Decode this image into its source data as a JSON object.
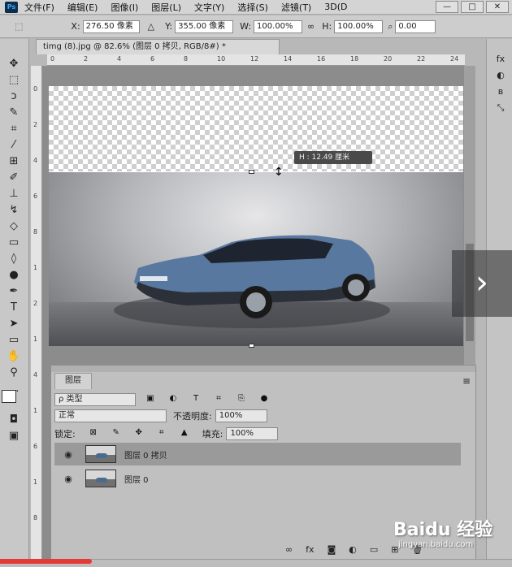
{
  "menubar": {
    "logo": "Ps",
    "items": [
      "文件(F)",
      "编辑(E)",
      "图像(I)",
      "图层(L)",
      "文字(Y)",
      "选择(S)",
      "滤镜(T)",
      "3D(D"
    ]
  },
  "window_controls": [
    "—",
    "□",
    "✕"
  ],
  "options": {
    "x_label": "X:",
    "x_value": "276.50 像素",
    "y_label": "Y:",
    "y_value": "355.00 像素",
    "w_label": "W:",
    "w_value": "100.00%",
    "h_label": "H:",
    "h_value": "100.00%",
    "angle_value": "0.00"
  },
  "document": {
    "tab_title": "timg (8).jpg @ 82.6% (图层 0 拷贝, RGB/8#) *",
    "tab_close": "×"
  },
  "ruler_top_labels": [
    "0",
    "2",
    "4",
    "6",
    "8",
    "10",
    "12",
    "14",
    "16",
    "18",
    "20",
    "22",
    "24"
  ],
  "ruler_left_labels": [
    "0",
    "2",
    "4",
    "6",
    "8",
    "1",
    "2",
    "1",
    "4",
    "1",
    "6",
    "1",
    "8"
  ],
  "hud": {
    "text": "H :  12.49 厘米"
  },
  "layers_panel": {
    "tab": "图层",
    "kind_label": "ρ 类型",
    "blend_mode": "正常",
    "opacity_label": "不透明度:",
    "opacity_value": "100%",
    "lock_label": "锁定:",
    "fill_label": "填充:",
    "fill_value": "100%",
    "layers": [
      {
        "name": "图层 0 拷贝",
        "selected": true
      },
      {
        "name": "图层 0",
        "selected": false
      }
    ],
    "footer_icons": [
      "link-icon",
      "fx-icon",
      "mask-icon",
      "adjustment-icon",
      "folder-icon",
      "new-layer-icon",
      "trash-icon"
    ]
  },
  "watermark": {
    "brand": "Baidu 经验",
    "url": "jingyan.baidu.com"
  },
  "next_arrow": "›",
  "progress": {
    "fraction": 0.18,
    "color": "#e53935"
  }
}
